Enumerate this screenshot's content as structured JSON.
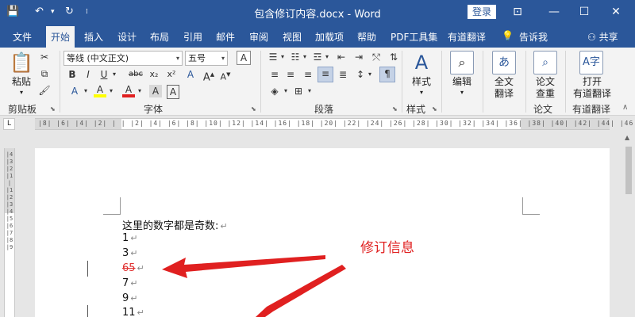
{
  "window": {
    "title": "包含修订内容.docx - Word",
    "login_label": "登录"
  },
  "tabs": [
    "文件",
    "开始",
    "插入",
    "设计",
    "布局",
    "引用",
    "邮件",
    "审阅",
    "视图",
    "加载项",
    "帮助",
    "PDF工具集",
    "有道翻译"
  ],
  "tell_me": "告诉我",
  "share": "共享",
  "ribbon": {
    "clipboard": {
      "paste": "粘贴",
      "label": "剪贴板"
    },
    "font": {
      "font_name": "等线 (中文正文)",
      "font_size": "五号",
      "label": "字体",
      "bold": "B",
      "italic": "I",
      "underline": "U",
      "strike": "abc",
      "subscript": "x₂",
      "superscript": "x²",
      "grow": "A",
      "shrink": "A",
      "highlight": "A",
      "fontcolor": "A"
    },
    "paragraph": {
      "label": "段落"
    },
    "styles": {
      "label": "样式",
      "button": "样式"
    },
    "editing": {
      "button": "编辑"
    },
    "translate_full": {
      "line1": "全文",
      "line2": "翻译"
    },
    "paper_check": {
      "line1": "论文",
      "line2": "查重",
      "label": "论文"
    },
    "open_youdao": {
      "line1": "打开",
      "line2": "有道翻译",
      "label": "有道翻译"
    }
  },
  "ruler": {
    "tab_selector": "L",
    "marks": "|8| |6| |4| |2| | | |2| |4| |6| |8| |10| |12| |14| |16| |18| |20| |22| |24| |26| |28| |30| |32| |34| |36| |38| |40| |42| |44| |46| |48|",
    "vmarks": "|4|3|2|1| |1|2|3|4|5|6|7|8|9"
  },
  "document": {
    "lines": [
      {
        "text": "这里的数字都是奇数:"
      },
      {
        "text": "1"
      },
      {
        "text": "3"
      },
      {
        "text": "65",
        "deleted": true
      },
      {
        "text": "7"
      },
      {
        "text": "9"
      },
      {
        "text": "11"
      }
    ],
    "paragraph_mark": "↵",
    "annotation": "修订信息"
  },
  "colors": {
    "brand": "#2b579a",
    "annotation": "#e02020",
    "deleted": "#e03030"
  }
}
